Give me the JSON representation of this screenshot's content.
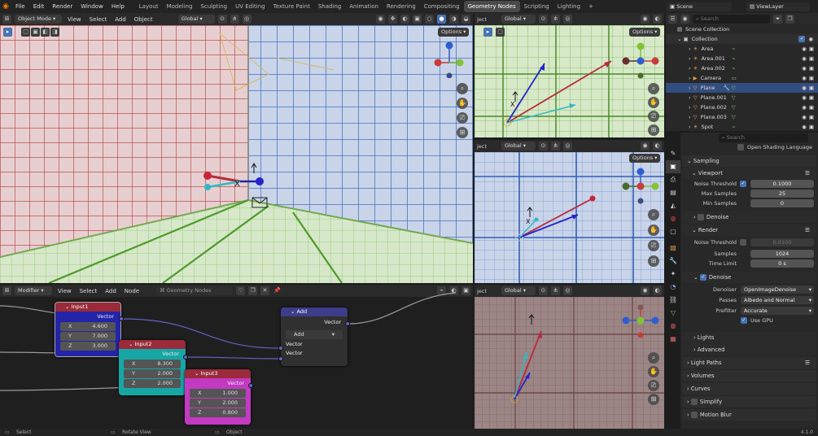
{
  "topbar": {
    "menus": [
      "File",
      "Edit",
      "Render",
      "Window",
      "Help"
    ],
    "workspaces": [
      "Layout",
      "Modeling",
      "Sculpting",
      "UV Editing",
      "Texture Paint",
      "Shading",
      "Animation",
      "Rendering",
      "Compositing",
      "Geometry Nodes",
      "Scripting",
      "Lighting"
    ],
    "active_workspace": "Geometry Nodes",
    "scene": "Scene",
    "view_layer": "ViewLayer"
  },
  "viewport_main": {
    "mode": "Object Mode",
    "menus": [
      "View",
      "Select",
      "Add",
      "Object"
    ],
    "transform": "Global",
    "options": "Options"
  },
  "viewport_small": {
    "header_label": "ject",
    "transform": "Global",
    "options": "Options"
  },
  "outliner": {
    "search_placeholder": "Search",
    "scene_collection": "Scene Collection",
    "collection": "Collection",
    "items": [
      "Area",
      "Area.001",
      "Area.002",
      "Camera",
      "Plane",
      "Plane.001",
      "Plane.002",
      "Plane.003",
      "Spot"
    ]
  },
  "properties": {
    "search_placeholder": "Search",
    "osl": "Open Shading Language",
    "sampling": "Sampling",
    "viewport": "Viewport",
    "vp_noise_threshold_label": "Noise Threshold",
    "vp_noise_threshold": "0.1000",
    "vp_max_samples_label": "Max Samples",
    "vp_max_samples": "25",
    "vp_min_samples_label": "Min Samples",
    "vp_min_samples": "0",
    "vp_denoise": "Denoise",
    "render": "Render",
    "r_noise_threshold_label": "Noise Threshold",
    "r_noise_threshold": "0.0100",
    "r_samples_label": "Samples",
    "r_samples": "1024",
    "r_time_limit_label": "Time Limit",
    "r_time_limit": "0 s",
    "r_denoise": "Denoise",
    "denoiser_label": "Denoiser",
    "denoiser": "OpenImageDenoise",
    "passes_label": "Passes",
    "passes": "Albedo and Normal",
    "prefilter_label": "Prefilter",
    "prefilter": "Accurate",
    "use_gpu": "Use GPU",
    "lights": "Lights",
    "advanced": "Advanced",
    "light_paths": "Light Paths",
    "volumes": "Volumes",
    "curves": "Curves",
    "simplify": "Simplify",
    "motion_blur": "Motion Blur"
  },
  "node_editor": {
    "mode": "Modifier",
    "menus": [
      "View",
      "Select",
      "Add",
      "Node"
    ],
    "tree": "Geometry Nodes",
    "nodes": {
      "input1": {
        "title": "Input1",
        "output": "Vector",
        "x": "4.600",
        "y": "7.000",
        "z": "3.000"
      },
      "input2": {
        "title": "Input2",
        "output": "Vector",
        "x": "8.300",
        "y": "2.000",
        "z": "2.000"
      },
      "input3": {
        "title": "Input3",
        "output": "Vector",
        "x": "1.000",
        "y": "2.000",
        "z": "0.800"
      },
      "add": {
        "title": "Add",
        "output": "Vector",
        "op": "Add",
        "in1": "Vector",
        "in2": "Vector"
      }
    },
    "axis_x": "X",
    "axis_y": "Y",
    "axis_z": "Z"
  },
  "status": {
    "select": "Select",
    "rotate": "Rotate View",
    "object": "Object",
    "version": "4.1.0"
  },
  "colors": {
    "accent": "#4772b3",
    "input1": "#2424a8",
    "input2": "#17a6a6",
    "input3": "#c23ac2",
    "add": "#3d3d8a"
  }
}
